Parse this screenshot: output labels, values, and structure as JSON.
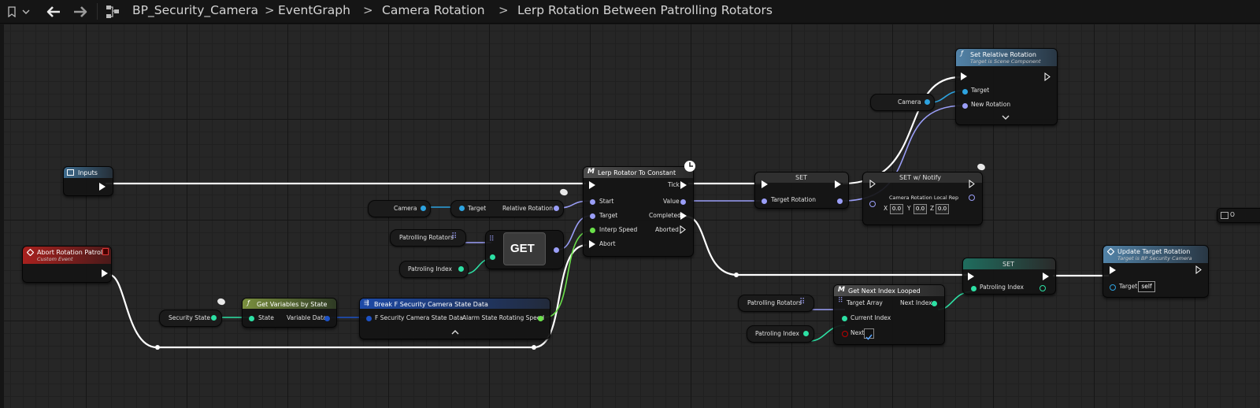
{
  "toolbar": {
    "bookmark_icon": "bookmark-icon",
    "back_icon": "arrow-left-icon",
    "forward_icon": "arrow-right-icon",
    "graph_icon": "blueprint-graph-icon",
    "breadcrumbs": [
      "BP_Security_Camera",
      "EventGraph",
      "Camera Rotation",
      "Lerp Rotation Between Patrolling Rotators"
    ],
    "separator": ">"
  },
  "nodes": {
    "inputs": {
      "title": "Inputs"
    },
    "abort": {
      "title": "Abort Rotation Patrol",
      "subtitle": "Custom Event"
    },
    "camera1": {
      "label": "Camera"
    },
    "relrot": {
      "target": "Target",
      "label": "Relative Rotation"
    },
    "patrollingRotators1": {
      "label": "Patrolling Rotators"
    },
    "patrolingIndex1": {
      "label": "Patroling Index"
    },
    "get": {
      "label": "GET"
    },
    "securityState": {
      "label": "Security State"
    },
    "getVars": {
      "title": "Get Variables by State",
      "state": "State",
      "variable_data": "Variable Data"
    },
    "breakStruct": {
      "title": "Break F Security Camera State Data",
      "input": "F Security Camera State Data",
      "output": "Alarm State Rotating Speed"
    },
    "lerp": {
      "title": "Lerp Rotator To Constant",
      "start": "Start",
      "target": "Target",
      "interp": "Interp Speed",
      "abort": "Abort",
      "tick": "Tick",
      "value": "Value",
      "completed": "Completed",
      "aborted": "Aborted"
    },
    "set1": {
      "title": "SET",
      "pin": "Target Rotation"
    },
    "setNotify": {
      "title": "SET w/ Notify",
      "pin": "Camera Rotation Local Rep",
      "x_label": "X",
      "x": "0.0",
      "y_label": "Y",
      "y": "0.0",
      "z_label": "Z",
      "z": "0.0"
    },
    "camera2": {
      "label": "Camera"
    },
    "setRelRot": {
      "title": "Set Relative Rotation",
      "subtitle": "Target is Scene Component",
      "target": "Target",
      "new_rotation": "New Rotation"
    },
    "set2": {
      "title": "SET",
      "pin": "Patroling Index"
    },
    "getNext": {
      "title": "Get Next Index Looped",
      "target_array": "Target Array",
      "current_index": "Current Index",
      "next": "Next",
      "next_index": "Next Index"
    },
    "patrollingRotators2": {
      "label": "Patrolling Rotators"
    },
    "patrolingIndex2": {
      "label": "Patroling Index"
    },
    "update": {
      "title": "Update Target Rotation",
      "subtitle": "Target is BP Security Camera",
      "target": "Target",
      "self": "self"
    },
    "offscreen": {
      "label": "O"
    }
  },
  "colors": {
    "exec": "#ffffff",
    "object": "#2da3e0",
    "rotator": "#9a9ef7",
    "float": "#6ae04a",
    "int": "#2de0a4",
    "struct": "#1d52c6",
    "bool": "#9b0000"
  }
}
